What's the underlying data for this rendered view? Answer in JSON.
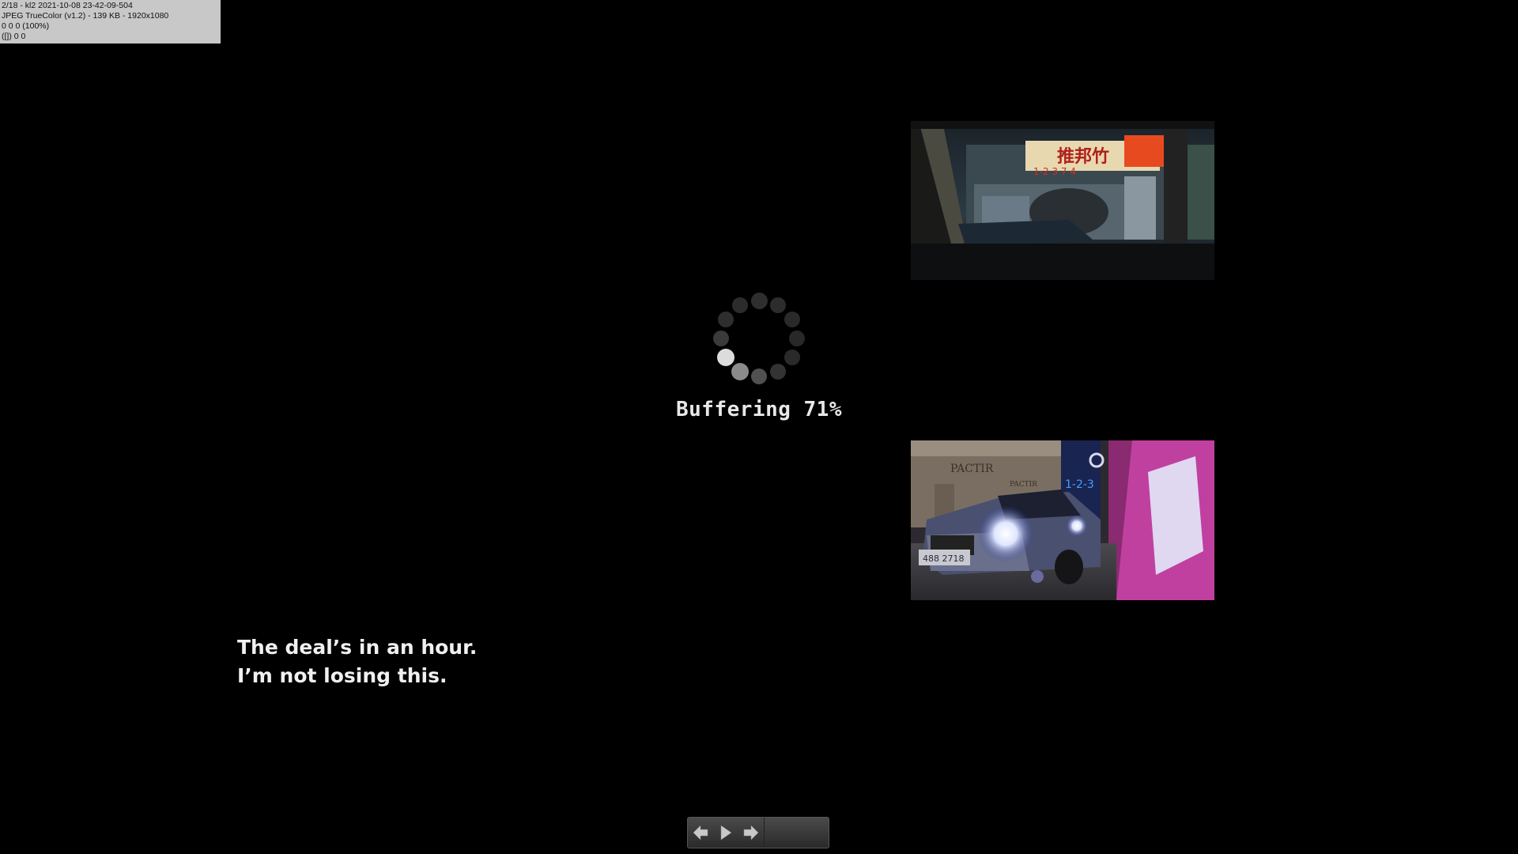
{
  "viewer_info": {
    "line1": "2/18 - kl2 2021-10-08 23-42-09-504",
    "line2": "JPEG TrueColor (v1.2) - 139 KB - 1920x1080",
    "line3": "0 0 0 (100%)",
    "line4": "([]) 0 0"
  },
  "loader": {
    "text": "Buffering 71%",
    "progress_percent": 71
  },
  "subtitle": {
    "line1": "The deal’s in an hour.",
    "line2": "I’m not losing this."
  },
  "thumbnails": [
    {
      "name": "thumb-car-window-street"
    },
    {
      "name": "thumb-car-headlights"
    }
  ],
  "nav": {
    "prev_icon": "arrow-left-icon",
    "play_icon": "play-icon",
    "next_icon": "arrow-right-icon"
  },
  "colors": {
    "background": "#000000",
    "text": "#f0f0f0",
    "info_box": "#c8c8c8"
  }
}
